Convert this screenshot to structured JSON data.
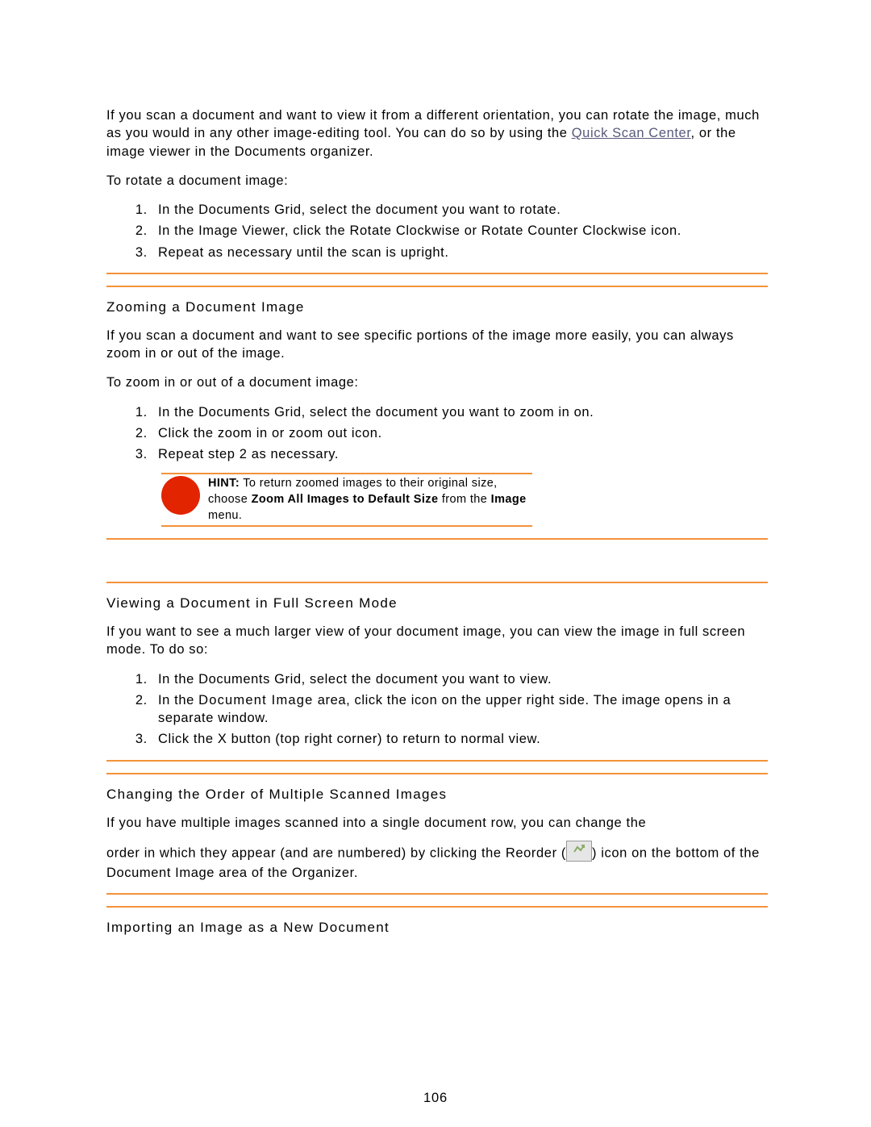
{
  "rotate": {
    "intro_a": "If you scan a document and want to view it from a different orientation, you can rotate the image, much as you would in any other image-editing tool. You can do so by using the ",
    "link": "Quick Scan Center",
    "intro_b": ", or the image viewer in the Documents organizer.",
    "lead": "To rotate a document image:",
    "steps": [
      "In the Documents Grid, select the document you want to rotate.",
      "In the Image Viewer, click the Rotate Clockwise or Rotate Counter Clockwise icon.",
      "Repeat as necessary until the scan is upright."
    ]
  },
  "zoom": {
    "heading": "Zooming a Document Image",
    "intro": "If you scan a document and want to see specific portions of the image more easily, you can always zoom in or out of the image.",
    "lead": "To zoom in or out of a document image:",
    "steps": [
      "In the Documents Grid, select the document you want to zoom in on.",
      "Click the zoom in or zoom out icon.",
      "Repeat step 2 as necessary."
    ],
    "hint_label": "HINT:",
    "hint_a": " To return zoomed images to their original size, choose ",
    "hint_strong": "Zoom All Images to Default Size",
    "hint_b": " from the ",
    "hint_strong2": "Image",
    "hint_c": " menu."
  },
  "fullscreen": {
    "heading": "Viewing a Document in Full Screen Mode",
    "intro": "If you want to see a much larger view of your document image, you can view the image in full screen mode. To do so:",
    "step1": "In the Documents Grid, select the document you want to view.",
    "step2_a": "In the ",
    "step2_strong": "Document Image",
    "step2_b": " area, click the icon on the upper right side. The image opens in a separate window.",
    "step3_a": "Click the ",
    "step3_x": "X",
    "step3_b": " button (top right corner) to return to normal view."
  },
  "reorder": {
    "heading": "Changing the Order of Multiple Scanned Images",
    "p1": "If you have multiple images scanned into a single document row, you can change the",
    "p2_a": "order in which they appear (and are numbered) by clicking the Reorder (",
    "p2_b": ") icon on the bottom of the Document Image area of the Organizer."
  },
  "import": {
    "heading": "Importing an Image as a New Document"
  },
  "page_number": "106"
}
